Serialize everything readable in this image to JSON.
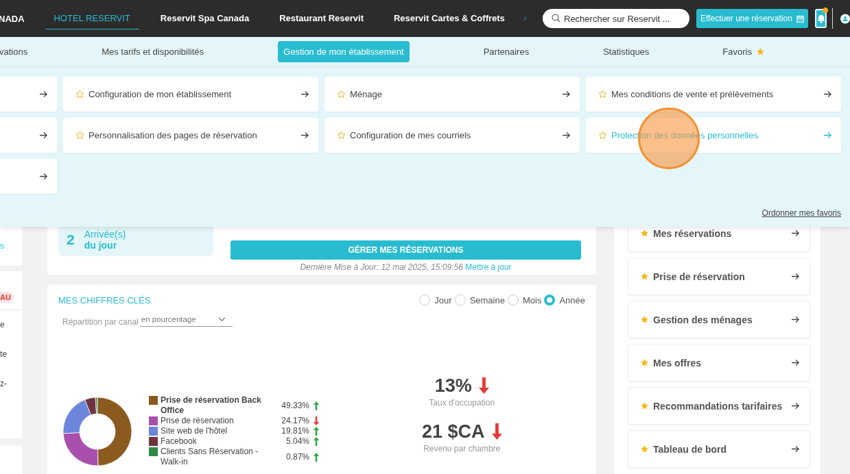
{
  "top_nav": {
    "brand": "NADA",
    "tabs": [
      {
        "label": "HOTEL RESERVIT",
        "selected": true
      },
      {
        "label": "Reservit Spa Canada",
        "selected": false
      },
      {
        "label": "Restaurant Reservit",
        "selected": false
      },
      {
        "label": "Reservit Cartes & Coffrets",
        "selected": false
      }
    ],
    "search": {
      "placeholder": "Rechercher sur Reservit ..."
    },
    "book_button": "Effectuer une réservation",
    "notifications": {
      "unread": true
    }
  },
  "sub_nav": [
    {
      "label": "vations",
      "selected": false,
      "kind": "link"
    },
    {
      "label": "Mes tarifs et disponibilités",
      "selected": false,
      "kind": "link"
    },
    {
      "label": "Gestion de mon établissement",
      "selected": true,
      "kind": "link"
    },
    {
      "label": "Partenaires",
      "selected": false,
      "kind": "link"
    },
    {
      "label": "Statistiques",
      "selected": false,
      "kind": "link"
    },
    {
      "label": "Favoris",
      "selected": false,
      "kind": "favorites"
    }
  ],
  "menu_panel": {
    "cards": [
      {
        "kind": "clipped"
      },
      {
        "kind": "link",
        "label": "Configuration de mon établissement",
        "favorite": false,
        "highlighted": false
      },
      {
        "kind": "link",
        "label": "Ménage",
        "favorite": false,
        "highlighted": false
      },
      {
        "kind": "link",
        "label": "Mes conditions de vente et prélèvements",
        "favorite": false,
        "highlighted": false
      },
      {
        "kind": "clipped"
      },
      {
        "kind": "link",
        "label": "Personnalisation des pages de réservation",
        "favorite": false,
        "highlighted": false
      },
      {
        "kind": "link",
        "label": "Configuration de mes courriels",
        "favorite": false,
        "highlighted": false
      },
      {
        "kind": "link",
        "label": "Protection des données personnelles",
        "favorite": false,
        "highlighted": true
      },
      {
        "kind": "clipped"
      }
    ],
    "footer_link": "Ordonner mes favoris"
  },
  "left_sidebar": [
    {
      "kind": "link",
      "text": "s"
    },
    {
      "kind": "badge",
      "text": "AU"
    },
    {
      "kind": "text",
      "text": "e"
    },
    {
      "kind": "text",
      "text": "te"
    },
    {
      "kind": "text",
      "text": "z-"
    }
  ],
  "arrivals": {
    "count": "2",
    "line1": "Arrivée(s)",
    "line2": "du jour"
  },
  "manage_button": "GÉRER MES RÉSERVATIONS",
  "last_update": {
    "text": "Dernière Mise à Jour: 12 mai 2025, 15:09:56",
    "link": "Mettre à jour"
  },
  "key_figures": {
    "title": "MES CHIFFRES CLÉS",
    "periods": [
      {
        "label": "Jour",
        "selected": false
      },
      {
        "label": "Semaine",
        "selected": false
      },
      {
        "label": "Mois",
        "selected": false
      },
      {
        "label": "Année",
        "selected": true
      }
    ],
    "breakdown": {
      "label": "Répartition par canal",
      "value": "en pourcentage"
    },
    "chart_data": {
      "type": "donut",
      "legend": "right",
      "categories": [
        "Prise de réservation Back Office",
        "Prise de réservation",
        "Site web de l'hôtel",
        "Facebook",
        "Clients Sans Réservation - Walk-in"
      ],
      "values": [
        49.33,
        24.17,
        19.81,
        5.04,
        0.87
      ]
    },
    "legend": [
      {
        "percent": "49.33%",
        "rising": true,
        "color": "#8b5a1f",
        "bold": true
      },
      {
        "percent": "24.17%",
        "rising": false,
        "color": "#a94fae",
        "bold": false
      },
      {
        "percent": "19.81%",
        "rising": true,
        "color": "#6b86dc",
        "bold": false
      },
      {
        "percent": "5.04%",
        "rising": true,
        "color": "#6e3341",
        "bold": false
      },
      {
        "percent": "0.87%",
        "rising": true,
        "color": "#2f8a48",
        "bold": false
      }
    ],
    "kpis": [
      {
        "value": "13%",
        "label": "Taux d'occupation",
        "rising": false
      },
      {
        "value": "21 $CA",
        "label": "Revenu par chambre",
        "rising": false
      }
    ]
  },
  "favorites": [
    {
      "label": "Mes réservations",
      "favorite": true
    },
    {
      "label": "Prise de réservation",
      "favorite": true
    },
    {
      "label": "Gestion des ménages",
      "favorite": true
    },
    {
      "label": "Mes offres",
      "favorite": true
    },
    {
      "label": "Recommandations tarifaires",
      "favorite": true
    },
    {
      "label": "Tableau de bord",
      "favorite": true
    }
  ]
}
